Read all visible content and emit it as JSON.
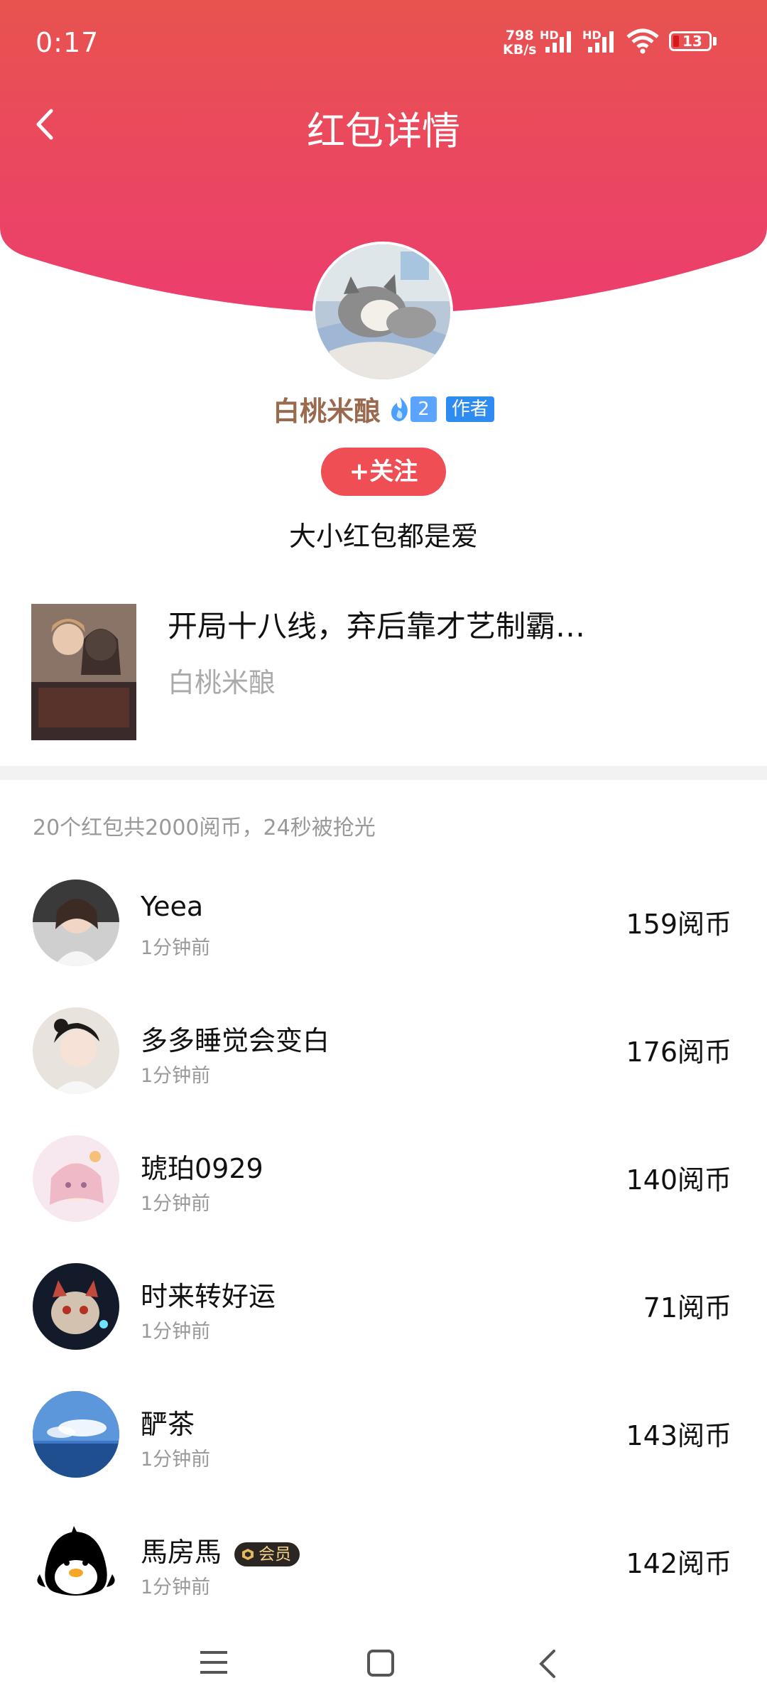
{
  "status_bar": {
    "time": "0:17",
    "speed_value": "798",
    "speed_unit": "KB/s",
    "hd1": "HD",
    "hd2": "HD",
    "battery": "13"
  },
  "header": {
    "title": "红包详情"
  },
  "author": {
    "name": "白桃米酿",
    "level": "2",
    "badge": "作者",
    "follow_label": "+关注",
    "message": "大小红包都是爱"
  },
  "book": {
    "title": "开局十八线，弃后靠才艺制霸…",
    "author": "白桃米酿"
  },
  "summary": "20个红包共2000阅币，24秒被抢光",
  "recipients": [
    {
      "name": "Yeea",
      "time": "1分钟前",
      "amount": "159阅币"
    },
    {
      "name": "多多睡觉会变白",
      "time": "1分钟前",
      "amount": "176阅币"
    },
    {
      "name": "琥珀0929",
      "time": "1分钟前",
      "amount": "140阅币"
    },
    {
      "name": "时来转好运",
      "time": "1分钟前",
      "amount": "71阅币"
    },
    {
      "name": "酽茶",
      "time": "1分钟前",
      "amount": "143阅币"
    },
    {
      "name": "馬房馬",
      "time": "1分钟前",
      "amount": "142阅币",
      "badge": "会员"
    }
  ],
  "colors": {
    "header_top": "#e8534f",
    "header_bottom": "#ec3d6e",
    "follow": "#ee4e54",
    "author_name": "#9a6a4f",
    "vip_bg": "#2b2621"
  }
}
